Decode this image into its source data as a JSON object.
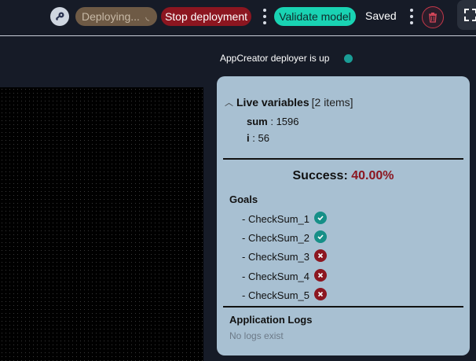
{
  "toolbar": {
    "deploying_label": "Deploying...",
    "stop_label": "Stop deployment",
    "validate_label": "Validate model",
    "saved_label": "Saved",
    "icons": [
      "key-icon",
      "spinner-icon",
      "more-vertical-icon",
      "trash-icon",
      "fullscreen-icon"
    ]
  },
  "status": {
    "deployer_text": "AppCreator deployer is up",
    "dot_color": "#1a9d96"
  },
  "panel": {
    "live_variables_title": "Live variables",
    "live_variables_count": "[2 items]",
    "variables": [
      {
        "name": "sum",
        "sep": " : ",
        "value": "1596"
      },
      {
        "name": "i",
        "sep": " : ",
        "value": "56"
      }
    ],
    "success_label": "Success:",
    "success_value": "40.00%",
    "goals_title": "Goals",
    "goals": [
      {
        "label": "- CheckSum_1",
        "status": "passed"
      },
      {
        "label": "- CheckSum_2",
        "status": "passed"
      },
      {
        "label": "- CheckSum_3",
        "status": "failed"
      },
      {
        "label": "- CheckSum_4",
        "status": "failed"
      },
      {
        "label": "- CheckSum_5",
        "status": "failed"
      }
    ],
    "logs_title": "Application Logs",
    "logs_empty": "No logs exist"
  },
  "colors": {
    "stop_red": "#8c1620",
    "validate_teal": "#19d3b3",
    "panel_bg": "#a8c0d2",
    "success_pct": "#8c1620"
  }
}
